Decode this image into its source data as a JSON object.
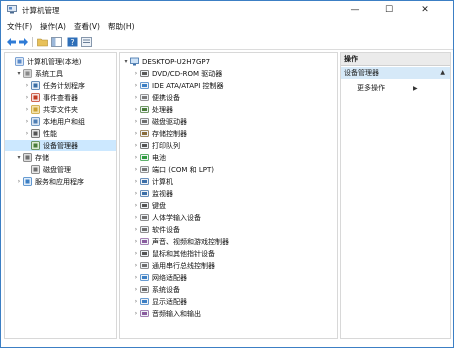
{
  "window": {
    "title": "计算机管理",
    "min_glyph": "—",
    "max_glyph": "☐",
    "close_glyph": "✕"
  },
  "menu": [
    "文件(F)",
    "操作(A)",
    "查看(V)",
    "帮助(H)"
  ],
  "left_tree": [
    {
      "label": "计算机管理(本地)",
      "arrow": "",
      "icon": "computer-management-icon",
      "depth": 0
    },
    {
      "label": "系统工具",
      "arrow": "▾",
      "icon": "system-tools-icon",
      "depth": 1
    },
    {
      "label": "任务计划程序",
      "arrow": "›",
      "icon": "task-scheduler-icon",
      "depth": 2
    },
    {
      "label": "事件查看器",
      "arrow": "›",
      "icon": "event-viewer-icon",
      "depth": 2
    },
    {
      "label": "共享文件夹",
      "arrow": "›",
      "icon": "shared-folders-icon",
      "depth": 2
    },
    {
      "label": "本地用户和组",
      "arrow": "›",
      "icon": "local-users-icon",
      "depth": 2
    },
    {
      "label": "性能",
      "arrow": "›",
      "icon": "performance-icon",
      "depth": 2
    },
    {
      "label": "设备管理器",
      "arrow": "",
      "icon": "device-manager-icon",
      "depth": 2,
      "selected": true
    },
    {
      "label": "存储",
      "arrow": "▾",
      "icon": "storage-icon",
      "depth": 1
    },
    {
      "label": "磁盘管理",
      "arrow": "",
      "icon": "disk-management-icon",
      "depth": 2
    },
    {
      "label": "服务和应用程序",
      "arrow": "›",
      "icon": "services-apps-icon",
      "depth": 1
    }
  ],
  "device_tree": {
    "root": "DESKTOP-U2H7GP7",
    "items": [
      "DVD/CD-ROM 驱动器",
      "IDE ATA/ATAPI 控制器",
      "便携设备",
      "处理器",
      "磁盘驱动器",
      "存储控制器",
      "打印队列",
      "电池",
      "端口 (COM 和 LPT)",
      "计算机",
      "监视器",
      "键盘",
      "人体学输入设备",
      "软件设备",
      "声音、视频和游戏控制器",
      "鼠标和其他指针设备",
      "通用串行总线控制器",
      "网络适配器",
      "系统设备",
      "显示适配器",
      "音频输入和输出"
    ]
  },
  "actions": {
    "header": "操作",
    "section": "设备管理器",
    "more": "更多操作"
  },
  "colors": {
    "accent": "#3c7fc4",
    "selection": "#cce8ff"
  }
}
